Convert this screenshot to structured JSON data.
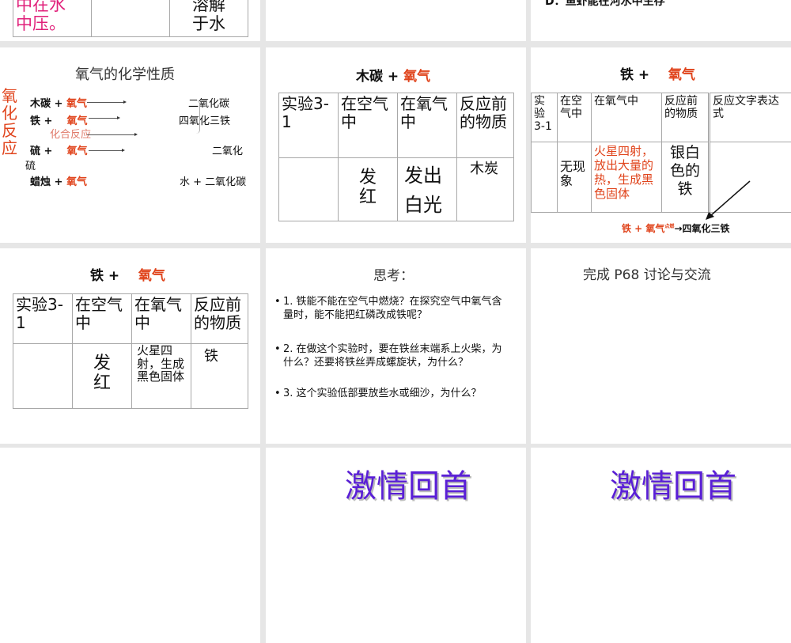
{
  "slides": {
    "s0a": {
      "line1": "中在水",
      "line2": "中压。",
      "col3_1": "溶解",
      "col3_2": "于水"
    },
    "s0c": {
      "text": "D．鱼虾能在河水中生存"
    },
    "s1": {
      "title": "氧气的化学性质",
      "side_label": "氧化反应",
      "rows": [
        {
          "left": "木碳 + ",
          "oxygen": "氧气",
          "right": "二氧化碳"
        },
        {
          "left": "铁 + ",
          "oxygen": "氧气",
          "right": "四氧化三铁"
        },
        {
          "left": "硫 + ",
          "oxygen": "氧气",
          "right": "二氧化"
        },
        {
          "left": "蜡烛 + ",
          "oxygen": "氧气",
          "right": "水 + 二氧化碳"
        }
      ],
      "combo_label": "化合反应",
      "wrap": "硫"
    },
    "s2": {
      "title_a": "木碳 + ",
      "title_b": "氧气",
      "headers": [
        "实验3-1",
        "在空气中",
        "在氧气中",
        "反应前的物质"
      ],
      "cells": [
        "",
        "发红",
        "发出白光",
        "木炭"
      ]
    },
    "s3": {
      "title_a": "铁 + ",
      "title_b": "氧气",
      "headers": [
        "实验3-1",
        "在空气中",
        "在氧气中",
        "反应前的物质",
        "反应文字表达式"
      ],
      "cells": [
        "",
        "无现象",
        "火星四射，放出大量的热，生成黑色固体",
        "银白色的铁",
        ""
      ],
      "equation_a": "铁 + 氧气",
      "condition": "点燃",
      "equation_b": "→四氧化三铁"
    },
    "s4": {
      "title_a": "铁 + ",
      "title_b": "氧气",
      "headers": [
        "实验3-1",
        "在空气中",
        "在氧气中",
        "反应前的物质"
      ],
      "cells": [
        "",
        "发红",
        "火星四射，生成黑色固体",
        "铁"
      ]
    },
    "s5": {
      "title": "思考：",
      "bullets": [
        "1. 铁能不能在空气中燃烧？在探究空气中氧气含量时，能不能把红磷改成铁呢？",
        "2. 在做这个实验时，要在铁丝末端系上火柴，为什么？还要将铁丝弄成螺旋状，为什么？",
        "3. 这个实验低部要放些水或细沙，为什么？"
      ]
    },
    "s6": {
      "title": "完成 P68   讨论与交流"
    },
    "s7": {
      "title": "激情回首"
    },
    "s8": {
      "title": "激情回首"
    }
  }
}
